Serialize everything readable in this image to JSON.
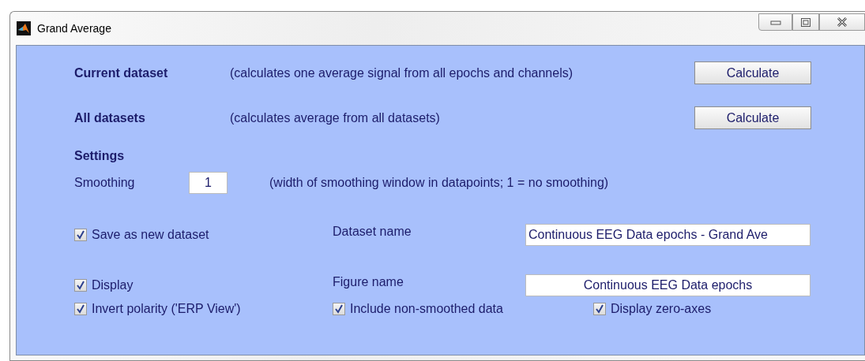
{
  "window": {
    "title": "Grand Average"
  },
  "sections": [
    {
      "title": "Current dataset",
      "description": "(calculates one average signal from all epochs and channels)",
      "button": "Calculate"
    },
    {
      "title": "All datasets",
      "description": "(calculates average from all datasets)",
      "button": "Calculate"
    }
  ],
  "settings": {
    "title": "Settings",
    "smoothing": {
      "label": "Smoothing",
      "value": "1",
      "hint": "(width of smoothing window in datapoints; 1 = no smoothing)"
    }
  },
  "save_option": {
    "label": "Save as new dataset",
    "checked": true
  },
  "dataset_name": {
    "label": "Dataset name",
    "value": "Continuous EEG Data epochs - Grand Ave"
  },
  "display_option": {
    "label": "Display",
    "checked": true
  },
  "figure_name": {
    "label": "Figure name",
    "value": "Continuous EEG Data epochs"
  },
  "bottom_options": [
    {
      "label": "Invert polarity ('ERP View')",
      "checked": true
    },
    {
      "label": "Include non-smoothed data",
      "checked": true
    },
    {
      "label": "Display zero-axes",
      "checked": true
    }
  ]
}
